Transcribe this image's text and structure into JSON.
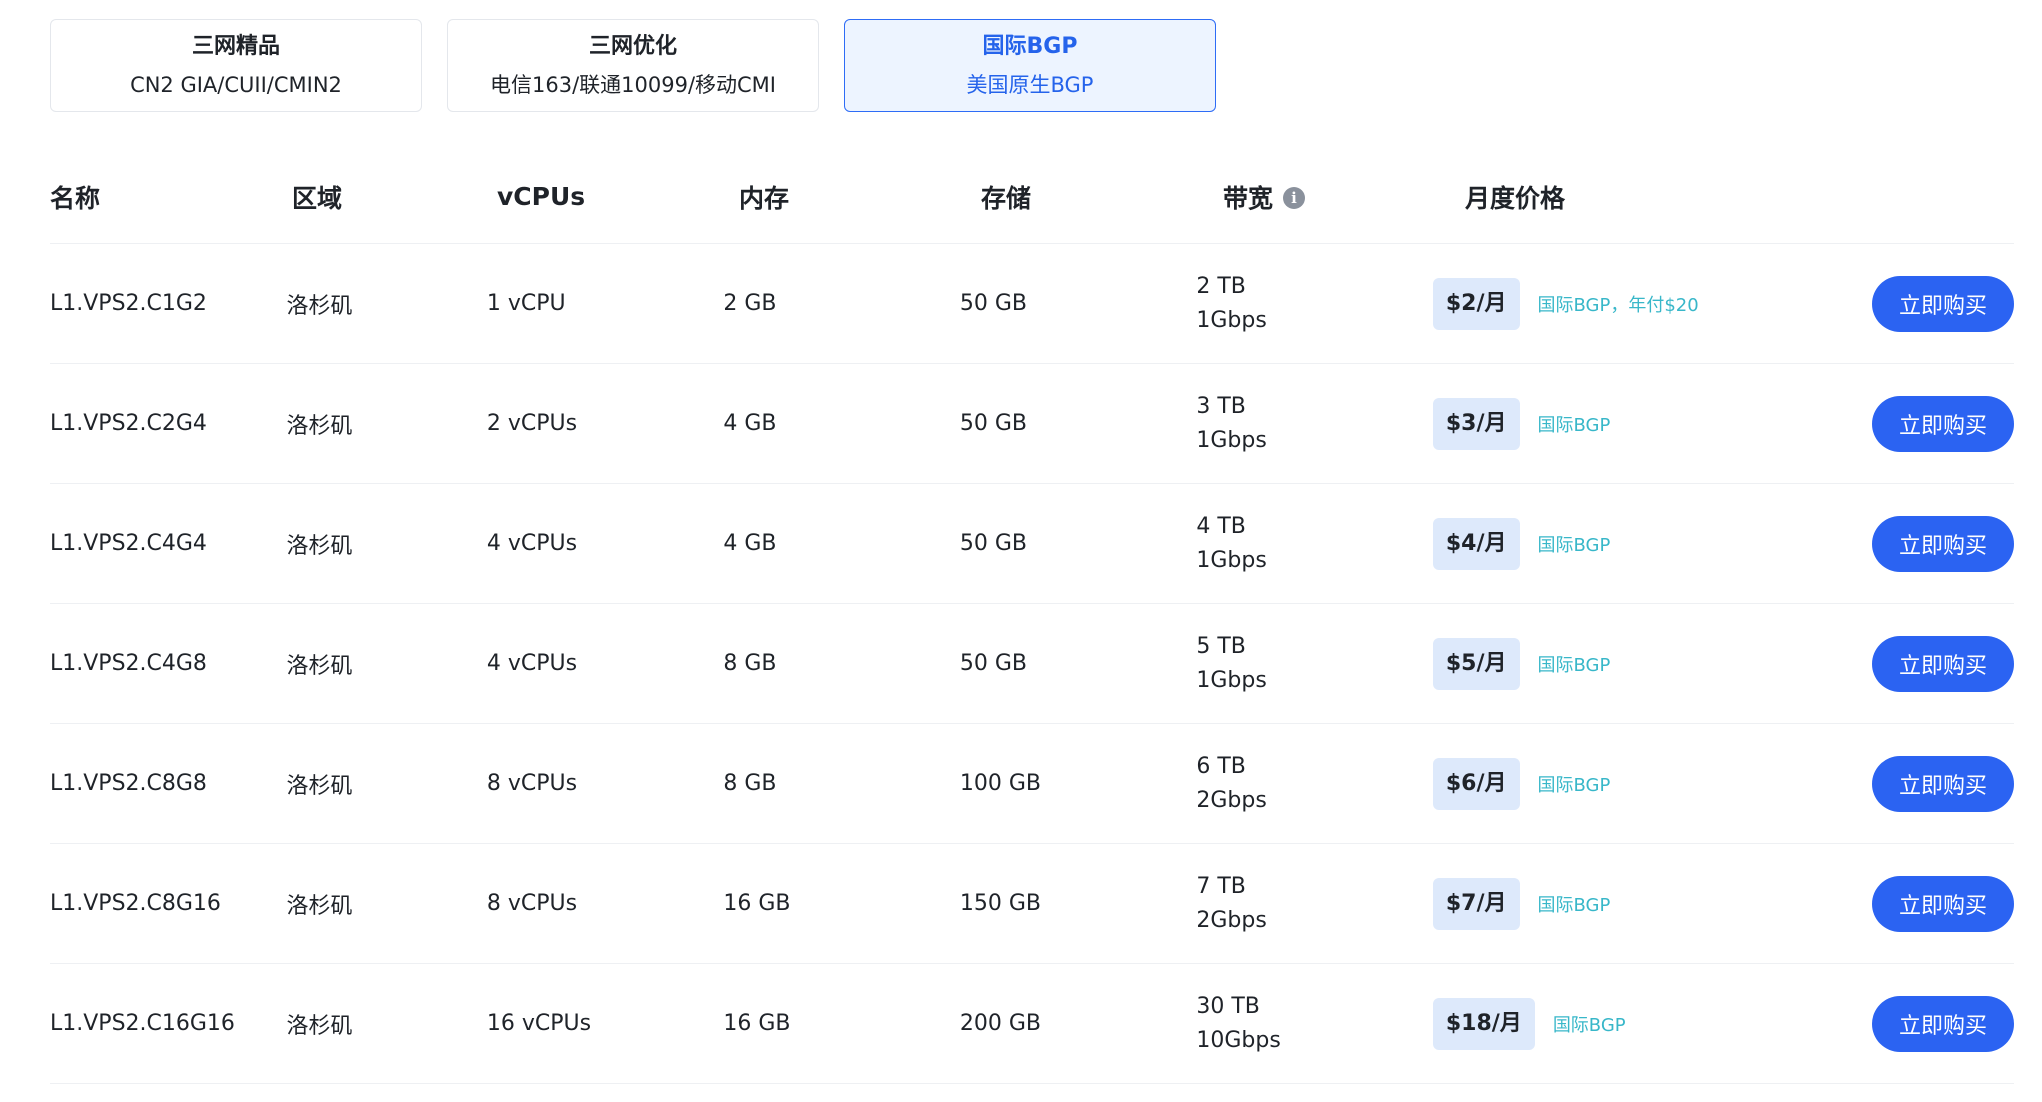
{
  "tabs": [
    {
      "title": "三网精品",
      "subtitle": "CN2 GIA/CUII/CMIN2",
      "active": false
    },
    {
      "title": "三网优化",
      "subtitle": "电信163/联通10099/移动CMI",
      "active": false
    },
    {
      "title": "国际BGP",
      "subtitle": "美国原生BGP",
      "active": true
    }
  ],
  "table": {
    "headers": {
      "name": "名称",
      "region": "区域",
      "vcpus": "vCPUs",
      "memory": "内存",
      "storage": "存储",
      "bandwidth": "带宽",
      "price": "月度价格"
    },
    "info_icon": "info-icon",
    "buy_label": "立即购买",
    "rows": [
      {
        "name": "L1.VPS2.C1G2",
        "region": "洛杉矶",
        "vcpus": "1 vCPU",
        "memory": "2 GB",
        "storage": "50 GB",
        "traffic": "2 TB",
        "speed": "1Gbps",
        "price": "$2/月",
        "note": "国际BGP，年付$20"
      },
      {
        "name": "L1.VPS2.C2G4",
        "region": "洛杉矶",
        "vcpus": "2 vCPUs",
        "memory": "4 GB",
        "storage": "50 GB",
        "traffic": "3 TB",
        "speed": "1Gbps",
        "price": "$3/月",
        "note": "国际BGP"
      },
      {
        "name": "L1.VPS2.C4G4",
        "region": "洛杉矶",
        "vcpus": "4 vCPUs",
        "memory": "4 GB",
        "storage": "50 GB",
        "traffic": "4 TB",
        "speed": "1Gbps",
        "price": "$4/月",
        "note": "国际BGP"
      },
      {
        "name": "L1.VPS2.C4G8",
        "region": "洛杉矶",
        "vcpus": "4 vCPUs",
        "memory": "8 GB",
        "storage": "50 GB",
        "traffic": "5 TB",
        "speed": "1Gbps",
        "price": "$5/月",
        "note": "国际BGP"
      },
      {
        "name": "L1.VPS2.C8G8",
        "region": "洛杉矶",
        "vcpus": "8 vCPUs",
        "memory": "8 GB",
        "storage": "100 GB",
        "traffic": "6 TB",
        "speed": "2Gbps",
        "price": "$6/月",
        "note": "国际BGP"
      },
      {
        "name": "L1.VPS2.C8G16",
        "region": "洛杉矶",
        "vcpus": "8 vCPUs",
        "memory": "16 GB",
        "storage": "150 GB",
        "traffic": "7 TB",
        "speed": "2Gbps",
        "price": "$7/月",
        "note": "国际BGP"
      },
      {
        "name": "L1.VPS2.C16G16",
        "region": "洛杉矶",
        "vcpus": "16 vCPUs",
        "memory": "16 GB",
        "storage": "200 GB",
        "traffic": "30 TB",
        "speed": "10Gbps",
        "price": "$18/月",
        "note": "国际BGP"
      }
    ]
  },
  "colors": {
    "accent": "#2b63f2",
    "active_tab_bg": "#edf4ff",
    "price_badge_bg": "#dde9fb",
    "note_text": "#38b7c9"
  }
}
